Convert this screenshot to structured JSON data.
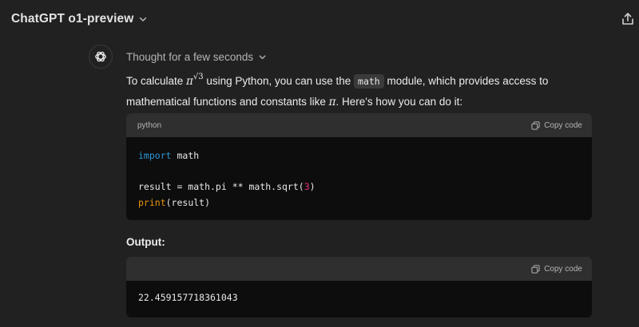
{
  "header": {
    "title": "ChatGPT o1-preview",
    "title_icon": "chevron-down-icon",
    "share_icon": "share-icon"
  },
  "message": {
    "avatar_icon": "openai-logo-icon",
    "thought_label": "Thought for a few seconds",
    "para_intro_a": "To calculate ",
    "para_pi": "π",
    "para_sqrt3": "√3",
    "para_intro_b": " using Python, you can use the ",
    "para_inline_code": "math",
    "para_intro_c": " module, which provides access to mathematical functions and constants like ",
    "para_pi2": "π",
    "para_intro_d": ". Here's how you can do it:"
  },
  "code_block_1": {
    "language": "python",
    "copy_label": "Copy code",
    "line1_kw": "import",
    "line1_rest": " math",
    "line3_a": "result = math.pi ** math.sqrt(",
    "line3_num": "3",
    "line3_b": ")",
    "line4_fn": "print",
    "line4_rest": "(result)"
  },
  "output": {
    "label": "Output:"
  },
  "code_block_2": {
    "copy_label": "Copy code",
    "value": "22.459157718361043"
  },
  "colors": {
    "background": "#212121",
    "code_bg": "#0d0d0d",
    "code_header_bg": "#2f2f2f",
    "keyword": "#2e95d3",
    "builtin": "#e9950c",
    "number": "#df3079"
  }
}
